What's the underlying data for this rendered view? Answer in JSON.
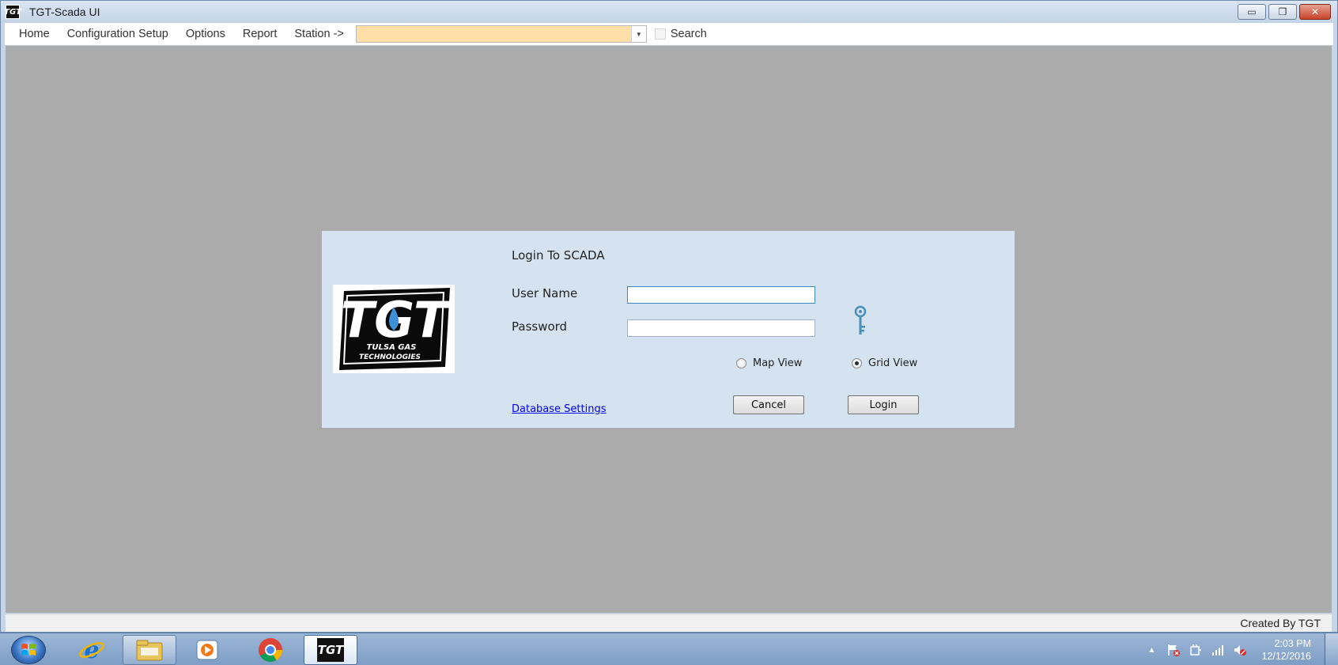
{
  "window": {
    "title": "TGT-Scada UI",
    "app_icon_text": "TGT",
    "minimize": "▭",
    "restore": "❐",
    "close": "✕"
  },
  "menu": {
    "items": [
      "Home",
      "Configuration Setup",
      "Options",
      "Report",
      "Station ->"
    ],
    "station_value": "",
    "search_label": "Search"
  },
  "login": {
    "title": "Login To SCADA",
    "username_label": "User Name",
    "password_label": "Password",
    "username_value": "",
    "password_value": "",
    "radio_map_label": "Map View",
    "radio_grid_label": "Grid View",
    "selected_view": "Grid View",
    "db_settings_link": "Database Settings",
    "cancel_label": "Cancel",
    "login_label": "Login",
    "logo_text_main": "TGT",
    "logo_text_line1": "TULSA GAS",
    "logo_text_line2": "TECHNOLOGIES"
  },
  "statusbar": {
    "created_by": "Created By TGT"
  },
  "taskbar": {
    "pinned": [
      "start-orb",
      "internet-explorer-icon",
      "file-explorer-icon",
      "media-player-icon",
      "chrome-icon",
      "tgt-scada-app-icon"
    ],
    "active_app_label": "TGT",
    "clock_time": "2:03 PM",
    "clock_date": "12/12/2016"
  },
  "colors": {
    "client_bg": "#ababab",
    "panel_bg": "#d5e2f0",
    "station_combo_bg": "#ffdfa8",
    "link": "#0000ee"
  }
}
